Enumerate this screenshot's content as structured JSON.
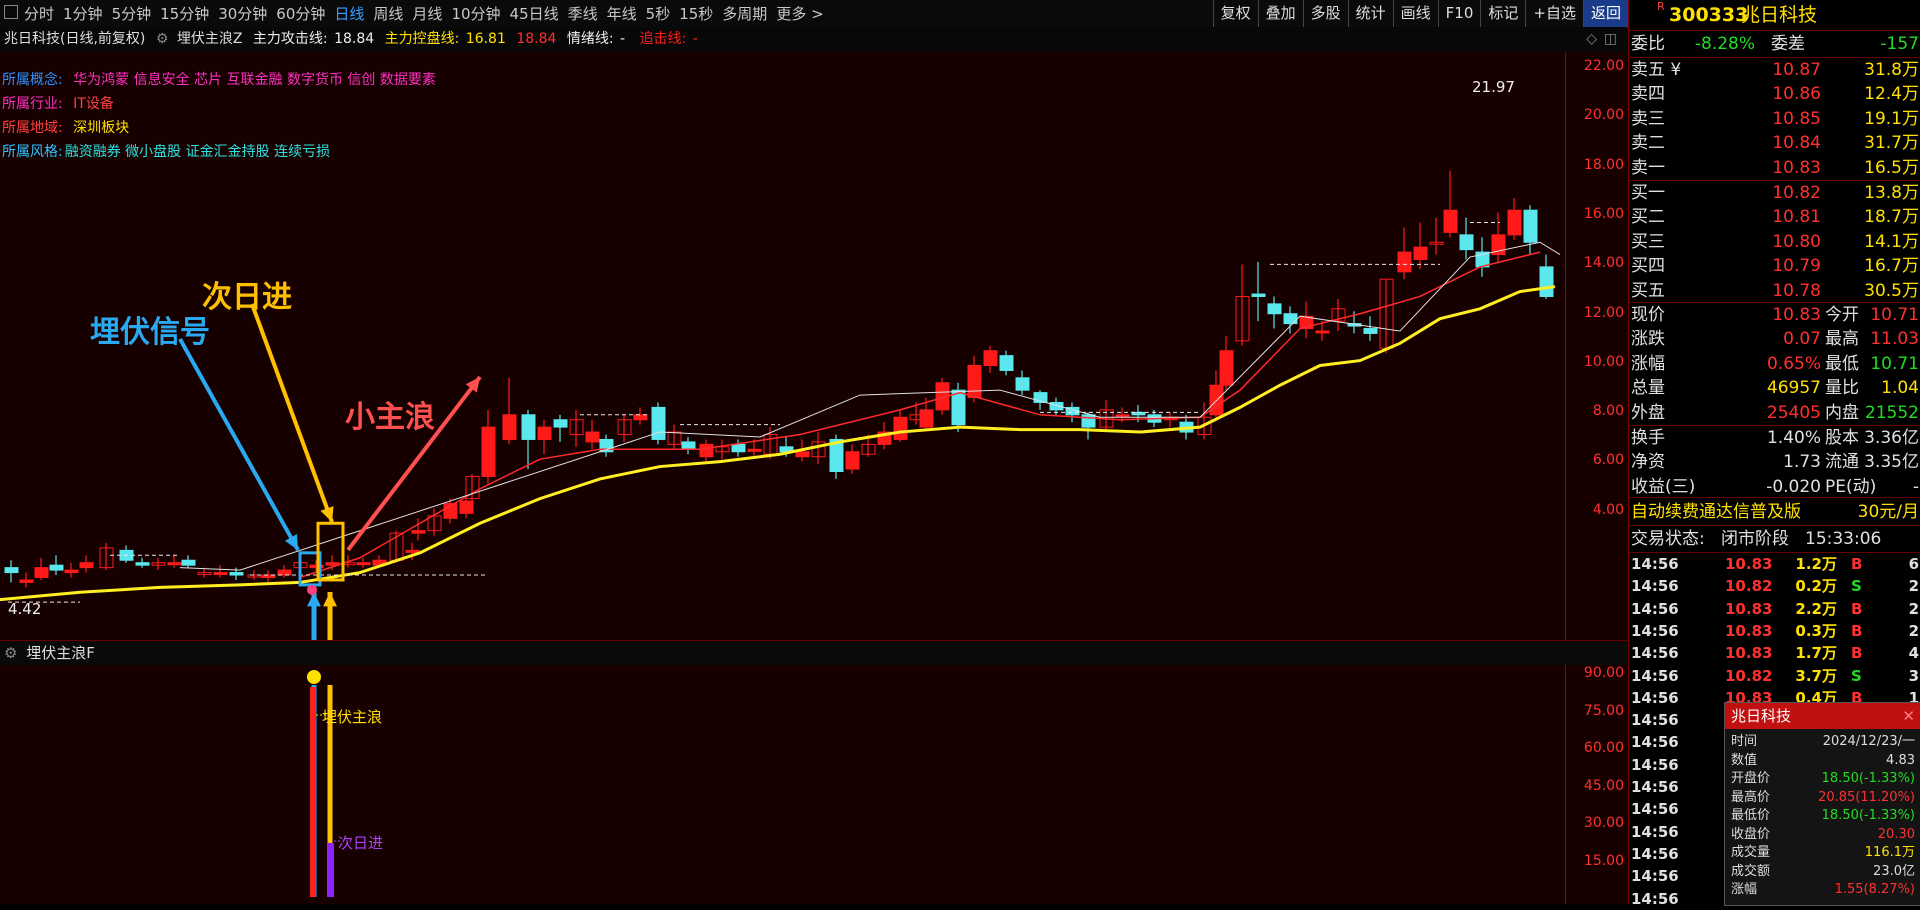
{
  "topbar": {
    "periods": [
      "分时",
      "1分钟",
      "5分钟",
      "15分钟",
      "30分钟",
      "60分钟",
      "日线",
      "周线",
      "月线",
      "10分钟",
      "45日线",
      "季线",
      "年线",
      "5秒",
      "15秒",
      "多周期",
      "更多 >"
    ],
    "active_period": "日线",
    "tools": [
      "复权",
      "叠加",
      "多股",
      "统计",
      "画线",
      "F10",
      "标记",
      "+自选",
      "返回"
    ]
  },
  "info_line": {
    "stock": "兆日科技(日线,前复权)",
    "indicator": "埋伏主浪Z",
    "attack_label": "主力攻击线:",
    "attack_value": "18.84",
    "control_label": "主力控盘线:",
    "control_value": "16.81",
    "extra_value": "18.84",
    "mood_label": "情绪线:",
    "mood_value": "-",
    "strike_label": "追击线:",
    "strike_value": "-"
  },
  "concepts": {
    "concept_label": "所属概念:",
    "concept_value": "华为鸿蒙 信息安全 芯片 互联金融 数字货币 信创 数据要素",
    "industry_label": "所属行业:",
    "industry_value": "IT设备",
    "region_label": "所属地域:",
    "region_value": "深圳板块",
    "style_label": "所属风格:",
    "style_value": "融资融券 微小盘股 证金汇金持股 连续亏损"
  },
  "annotations": {
    "ambush": "埋伏信号",
    "nextday": "次日进",
    "wave": "小主浪",
    "sub_ambush": "埋伏主浪",
    "sub_nextday": "次日进",
    "high_label": "21.97",
    "low_label": "4.42"
  },
  "main_axis": [
    "22.00",
    "20.00",
    "18.00",
    "16.00",
    "14.00",
    "12.00",
    "10.00",
    "8.00",
    "6.00",
    "4.00"
  ],
  "sub_axis": [
    "90.00",
    "75.00",
    "60.00",
    "45.00",
    "30.00",
    "15.00"
  ],
  "sub_header": "埋伏主浪F",
  "quote": {
    "code": "300333",
    "name": "兆日科技",
    "r_mark": "R",
    "weibi_label": "委比",
    "weibi": "-8.28%",
    "weicha_label": "委差",
    "weicha": "-157",
    "asks": [
      {
        "label": "卖五 ¥",
        "price": "10.87",
        "vol": "31.8万"
      },
      {
        "label": "卖四",
        "price": "10.86",
        "vol": "12.4万"
      },
      {
        "label": "卖三",
        "price": "10.85",
        "vol": "19.1万"
      },
      {
        "label": "卖二",
        "price": "10.84",
        "vol": "31.7万"
      },
      {
        "label": "卖一",
        "price": "10.83",
        "vol": "16.5万"
      }
    ],
    "bids": [
      {
        "label": "买一",
        "price": "10.82",
        "vol": "13.8万"
      },
      {
        "label": "买二",
        "price": "10.81",
        "vol": "18.7万"
      },
      {
        "label": "买三",
        "price": "10.80",
        "vol": "14.1万"
      },
      {
        "label": "买四",
        "price": "10.79",
        "vol": "16.7万"
      },
      {
        "label": "买五",
        "price": "10.78",
        "vol": "30.5万"
      }
    ],
    "stats": [
      {
        "l1": "现价",
        "v1": "10.83",
        "l2": "今开",
        "v2": "10.71"
      },
      {
        "l1": "涨跌",
        "v1": "0.07",
        "l2": "最高",
        "v2": "11.03"
      },
      {
        "l1": "涨幅",
        "v1": "0.65%",
        "l2": "最低",
        "v2": "10.71"
      },
      {
        "l1": "总量",
        "v1": "46957",
        "l2": "量比",
        "v2": "1.04"
      },
      {
        "l1": "外盘",
        "v1": "25405",
        "l2": "内盘",
        "v2": "21552"
      }
    ],
    "fin": [
      {
        "l1": "换手",
        "v1": "1.40%",
        "l2": "股本",
        "v2": "3.36亿"
      },
      {
        "l1": "净资",
        "v1": "1.73",
        "l2": "流通",
        "v2": "3.35亿"
      },
      {
        "l1": "收益(三)",
        "v1": "-0.020",
        "l2": "PE(动)",
        "v2": "-"
      }
    ],
    "promo": "自动续费通达信普及版",
    "promo_price": "30元/月",
    "status_label": "交易状态:",
    "status": "闭市阶段",
    "status_time": "15:33:06"
  },
  "ticks": [
    {
      "t": "14:56",
      "p": "10.83",
      "v": "1.2万",
      "s": "B",
      "n": "6"
    },
    {
      "t": "14:56",
      "p": "10.82",
      "v": "0.2万",
      "s": "S",
      "n": "2"
    },
    {
      "t": "14:56",
      "p": "10.83",
      "v": "2.2万",
      "s": "B",
      "n": "2"
    },
    {
      "t": "14:56",
      "p": "10.83",
      "v": "0.3万",
      "s": "B",
      "n": "2"
    },
    {
      "t": "14:56",
      "p": "10.83",
      "v": "1.7万",
      "s": "B",
      "n": "4"
    },
    {
      "t": "14:56",
      "p": "10.82",
      "v": "3.7万",
      "s": "S",
      "n": "3"
    },
    {
      "t": "14:56",
      "p": "10.83",
      "v": "0.4万",
      "s": "B",
      "n": "1"
    },
    {
      "t": "14:56"
    },
    {
      "t": "14:56"
    },
    {
      "t": "14:56"
    },
    {
      "t": "14:56"
    },
    {
      "t": "14:56"
    },
    {
      "t": "14:56"
    },
    {
      "t": "14:56"
    },
    {
      "t": "14:56"
    },
    {
      "t": "14:56"
    }
  ],
  "popup": {
    "title": "兆日科技",
    "rows": [
      {
        "k": "时间",
        "v": "2024/12/23/一",
        "c": "#ddd"
      },
      {
        "k": "数值",
        "v": "4.83",
        "c": "#ddd"
      },
      {
        "k": "开盘价",
        "v": "18.50(-1.33%)",
        "c": "#22dd22"
      },
      {
        "k": "最高价",
        "v": "20.85(11.20%)",
        "c": "#ff3030"
      },
      {
        "k": "最低价",
        "v": "18.50(-1.33%)",
        "c": "#22dd22"
      },
      {
        "k": "收盘价",
        "v": "20.30",
        "c": "#ff3030"
      },
      {
        "k": "成交量",
        "v": "116.1万",
        "c": "#ffe000"
      },
      {
        "k": "成交额",
        "v": "23.0亿",
        "c": "#ddd"
      },
      {
        "k": "涨幅",
        "v": "1.55(8.27%)",
        "c": "#ff3030"
      }
    ]
  },
  "colors": {
    "up": "#ff1a1a",
    "down": "#5ae8ee",
    "ma": "#ffee22",
    "ma_short": "#ff2a2a",
    "ambush": "#2aa8f0",
    "next": "#ffc000",
    "wave": "#ff5050"
  }
}
